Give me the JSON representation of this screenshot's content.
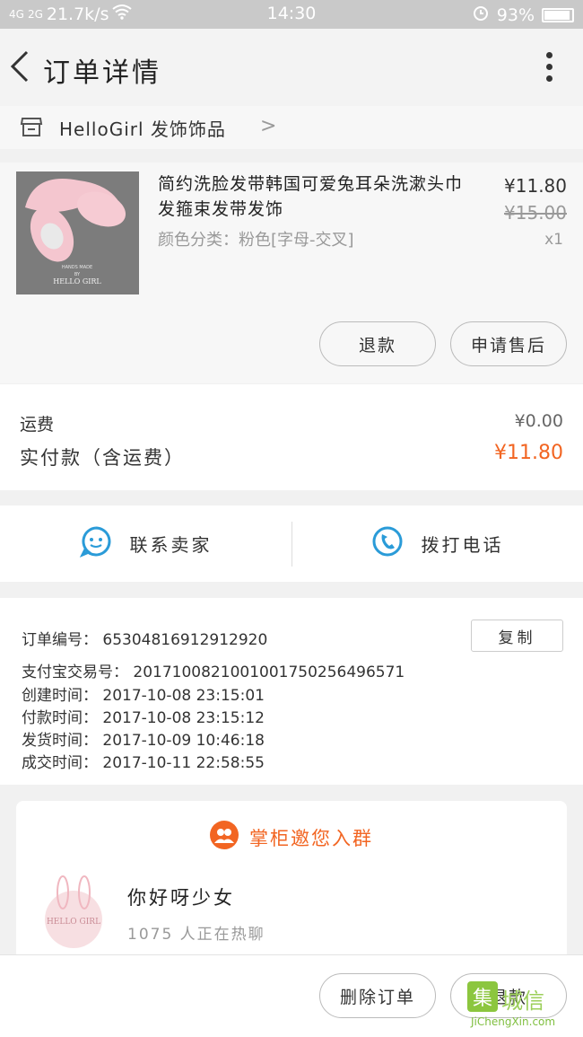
{
  "status_bar": {
    "signal_1": "4G",
    "signal_2": "2G",
    "speed": "21.7k/s",
    "time": "14:30",
    "battery": "93%"
  },
  "nav": {
    "title": "订单详情"
  },
  "shop": {
    "name": "HelloGirl 发饰饰品"
  },
  "product": {
    "title": "简约洗脸发带韩国可爱兔耳朵洗漱头巾发箍束发带发饰",
    "spec": "颜色分类：粉色[字母-交叉]",
    "price": "¥11.80",
    "original_price": "¥15.00",
    "quantity": "x1",
    "image_text_top": "HANDS MADE",
    "image_text_mid": "BY",
    "image_text_brand": "HELLO GIRL",
    "refund_label": "退款",
    "aftersale_label": "申请售后"
  },
  "fees": {
    "shipping_label": "运费",
    "shipping_value": "¥0.00",
    "paid_label": "实付款（含运费）",
    "paid_value": "¥11.80"
  },
  "contact": {
    "seller_label": "联系卖家",
    "phone_label": "拨打电话"
  },
  "order_info": {
    "order_no": "订单编号：  65304816912912920",
    "alipay_no": "支付宝交易号：  2017100821001001750256496571",
    "created": "创建时间：  2017-10-08 23:15:01",
    "paid": "付款时间：  2017-10-08 23:15:12",
    "shipped": "发货时间：  2017-10-09 10:46:18",
    "completed": "成交时间：  2017-10-11 22:58:55",
    "copy_label": "复制"
  },
  "group": {
    "header": "掌柜邀您入群",
    "name": "你好呀少女",
    "count": "1075 人正在热聊",
    "logo_text": "HELLO GIRL"
  },
  "bottom": {
    "delete_label": "删除订单",
    "refund_label": "退款"
  },
  "watermark": {
    "brand": "城信",
    "url": "JiChengXin.com"
  },
  "colors": {
    "accent_orange": "#f26522",
    "contact_blue": "#2a9bd8",
    "background": "#f1f1f1"
  }
}
